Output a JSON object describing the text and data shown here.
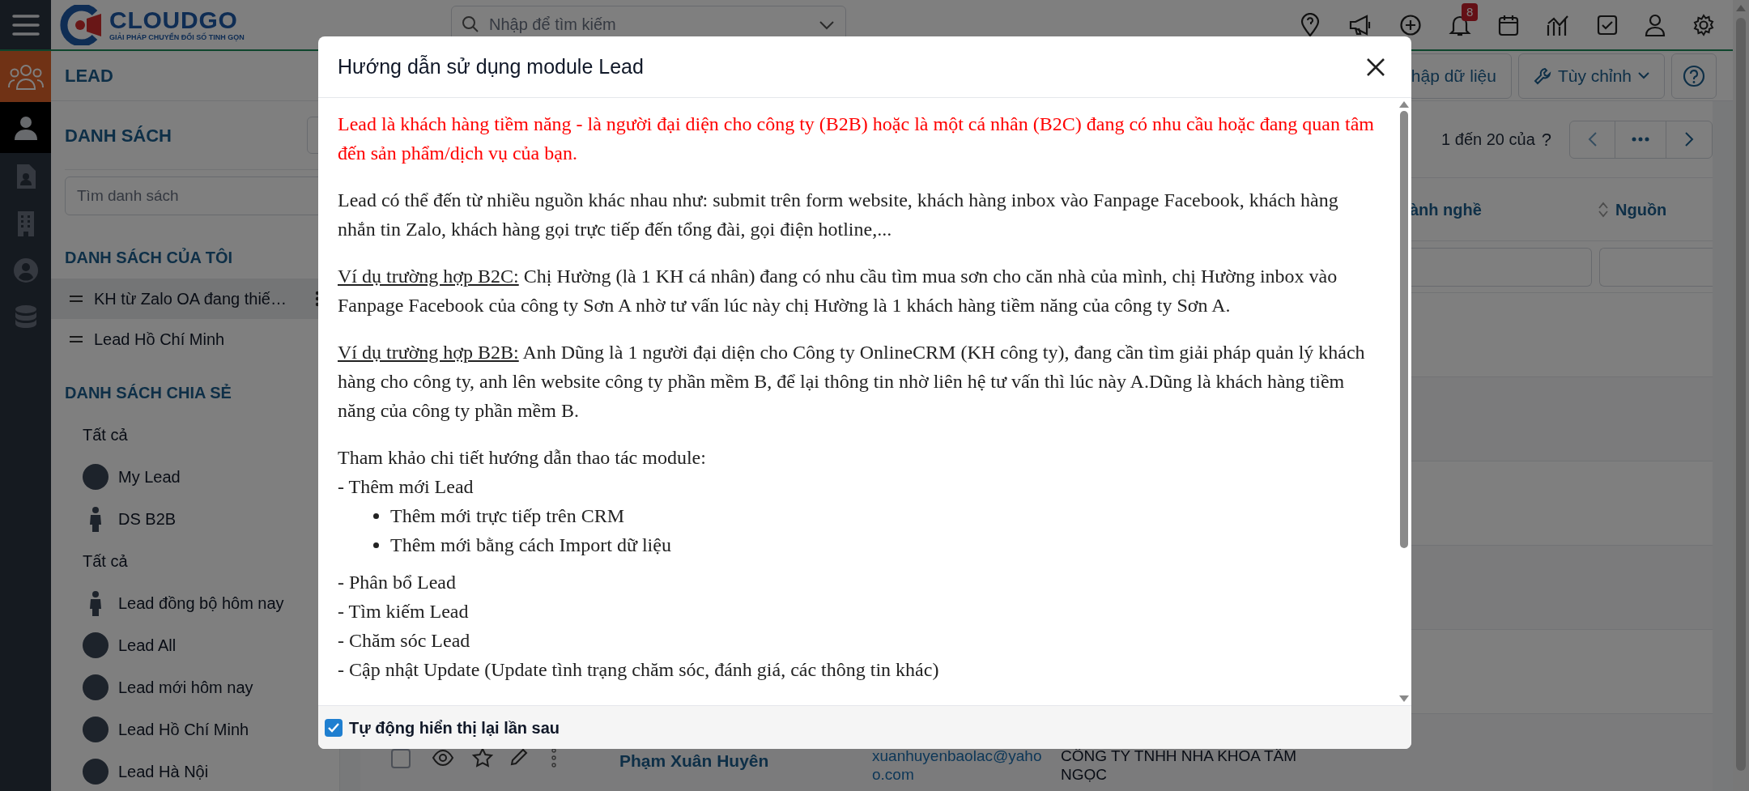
{
  "top_bar": {
    "logo": {
      "name": "CLOUDGO",
      "tagline": "GIẢI PHÁP CHUYỂN ĐỔI SỐ TINH GỌN"
    },
    "search": {
      "placeholder": "Nhập để tìm kiếm"
    },
    "notification_count": "8"
  },
  "rail": {
    "items": [
      {
        "kind": "person",
        "selected": true
      },
      {
        "kind": "document",
        "selected": false
      },
      {
        "kind": "building",
        "selected": false
      },
      {
        "kind": "account",
        "selected": false
      },
      {
        "kind": "database",
        "selected": false
      }
    ]
  },
  "module_header": {
    "title": "LEAD",
    "buttons": [
      {
        "kind": "import",
        "label": "hập dữ liệu"
      },
      {
        "kind": "customize",
        "label": "Tùy chỉnh"
      },
      {
        "kind": "help"
      }
    ]
  },
  "sidebar": {
    "title": "DANH SÁCH",
    "search": {
      "placeholder": "Tìm danh sách"
    },
    "my_lists": {
      "title": "DANH SÁCH CỦA TÔI",
      "items": [
        {
          "label": "KH từ Zalo OA đang thiế…",
          "selected": true
        },
        {
          "label": "Lead Hồ Chí Minh",
          "selected": false
        }
      ]
    },
    "shared_lists": {
      "title": "DANH SÁCH CHIA SẺ",
      "groups": [
        {
          "label": "Tất cả",
          "items": [
            {
              "label": "My Lead",
              "kind": "circle"
            },
            {
              "label": "DS B2B",
              "kind": "figure"
            }
          ]
        },
        {
          "label": "Tất cả",
          "items": [
            {
              "label": "Lead đồng bộ hôm nay",
              "kind": "figure"
            },
            {
              "label": "Lead All",
              "kind": "circle"
            },
            {
              "label": "Lead mới hôm nay",
              "kind": "circle"
            },
            {
              "label": "Lead Hồ Chí Minh",
              "kind": "circle"
            },
            {
              "label": "Lead Hà Nội",
              "kind": "circle"
            }
          ]
        }
      ]
    }
  },
  "pagination": {
    "range": "1 đến 20 của",
    "total": "?"
  },
  "table": {
    "columns": [
      "ành nghề",
      "Nguồn"
    ],
    "rows": [
      {
        "name": "Phạm Xuân Huyên",
        "email": "xuanhuyenbaolac@yahoo.com",
        "company": "CÔNG TY TNHH NHA KHOA TÂM NGỌC",
        "checked": false
      }
    ]
  },
  "modal": {
    "title": "Hướng dẫn sử dụng module Lead",
    "body": [
      {
        "kind": "note",
        "text": "Lead là khách hàng tiềm năng - là người đại diện cho công ty (B2B) hoặc là một cá nhân (B2C) đang có nhu cầu hoặc đang quan tâm đến sản phẩm/dịch vụ của bạn."
      },
      {
        "kind": "paragraph",
        "text": "Lead có thể đến từ nhiều nguồn khác nhau như: submit trên form website, khách hàng inbox vào Fanpage Facebook, khách hàng nhắn tin Zalo, khách hàng gọi trực tiếp đến tổng đài, gọi điện hotline,..."
      },
      {
        "kind": "example",
        "label": "Ví dụ trường hợp B2C:",
        "text": "Chị Hường (là 1 KH cá nhân) đang có nhu cầu tìm mua sơn cho căn nhà của mình, chị Hường inbox vào Fanpage Facebook của công ty Sơn A nhờ tư vấn lúc này chị Hường là 1 khách hàng tiềm năng của công ty Sơn A."
      },
      {
        "kind": "example",
        "label": "Ví dụ trường hợp B2B:",
        "text": "Anh Dũng là 1 người đại diện cho Công ty OnlineCRM (KH công ty), đang cần tìm giải pháp quản lý khách hàng cho công ty, anh lên website công ty phần mềm B, để lại thông tin nhờ liên hệ tư vấn thì lúc này A.Dũng là khách hàng tiềm năng của công ty phần mềm B."
      },
      {
        "kind": "lines",
        "lines": [
          "Tham khảo chi tiết hướng dẫn thao tác module:",
          "- Thêm mới Lead"
        ]
      },
      {
        "kind": "bullets",
        "items": [
          "Thêm mới trực tiếp trên CRM",
          "Thêm mới bằng cách Import dữ liệu"
        ]
      },
      {
        "kind": "lines",
        "lines": [
          "- Phân bổ Lead",
          "- Tìm kiếm Lead",
          "- Chăm sóc Lead",
          "- Cập nhật Update (Update tình trạng chăm sóc, đánh giá, các thông tin khác)"
        ]
      }
    ],
    "footer_checkbox": {
      "label": "Tự động hiển thị lại lần sau",
      "checked": true
    }
  }
}
